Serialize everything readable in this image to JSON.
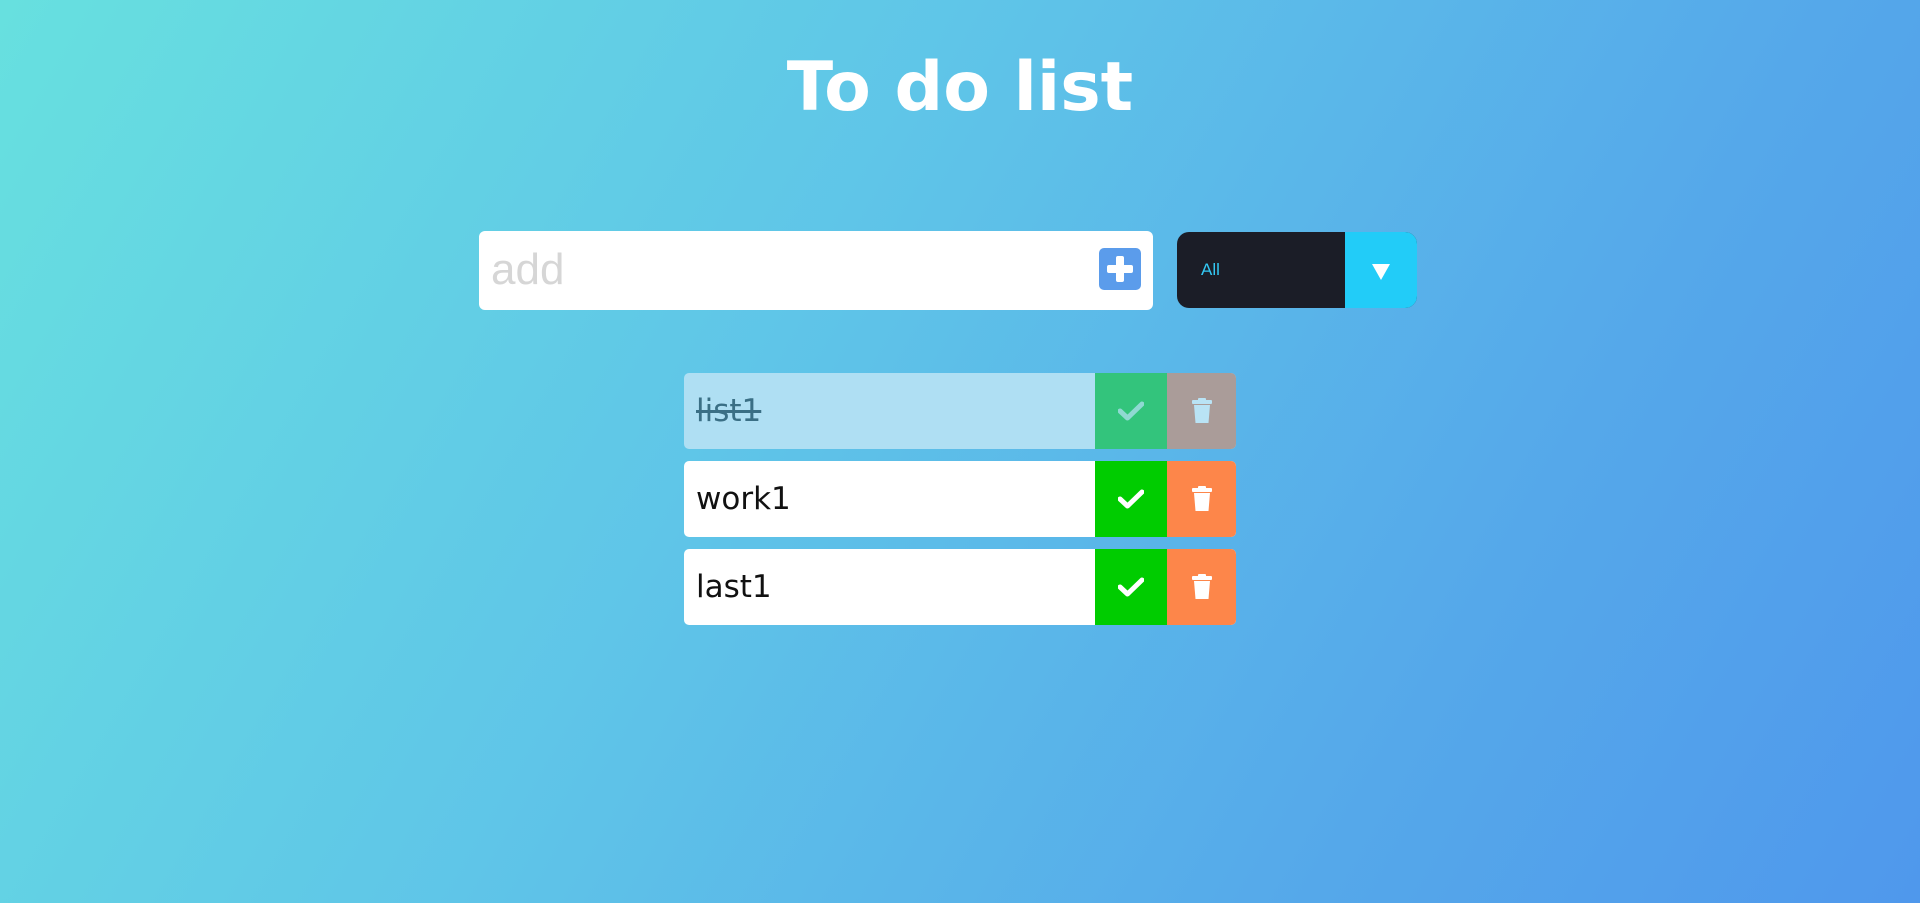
{
  "app": {
    "title": "To do list"
  },
  "add_form": {
    "placeholder": "add",
    "value": "",
    "button_icon": "plus-square-icon"
  },
  "filter": {
    "selected": "All",
    "dropdown_icon": "triangle-down-icon"
  },
  "todos": [
    {
      "text": "list1",
      "completed": true
    },
    {
      "text": "work1",
      "completed": false
    },
    {
      "text": "last1",
      "completed": false
    }
  ],
  "colors": {
    "complete_button": "#00cc00",
    "trash_button": "#fd864a",
    "add_button": "#5b9ceb",
    "filter_bg": "#1b1d27",
    "filter_arrow_bg": "#22ccf8",
    "filter_text": "#33c8f3",
    "completed_item_bg": "#afdff3"
  }
}
